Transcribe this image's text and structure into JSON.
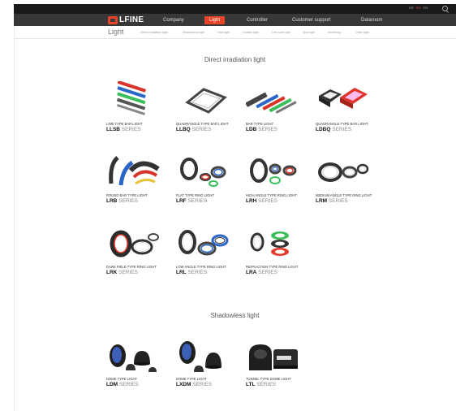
{
  "topbar": {
    "lang_kr": "KR",
    "lang_en": "EN",
    "lang_cn": "CN"
  },
  "nav": {
    "logo_text": "LFINE",
    "items": [
      "Company",
      "Light",
      "Controller",
      "Customer support",
      "Dataroom"
    ],
    "active_index": 1
  },
  "subnav": {
    "title": "Light",
    "items": [
      "Direct irradiation light",
      "Shadowless light",
      "Dark light",
      "Coaxial light",
      "Line scan light",
      "Spot light",
      "Accessory",
      "Order light"
    ]
  },
  "sections": [
    {
      "title": "Direct irradiation light",
      "products": [
        {
          "name": "LINE TYPE BAR LIGHT",
          "code": "LLSB",
          "suffix": "SERIES",
          "icon": "bar-lights-icon"
        },
        {
          "name": "QUADRANGLE TYPE BAR LIGHT",
          "code": "LLBQ",
          "suffix": "SERIES",
          "icon": "quadrangle-frame-icon"
        },
        {
          "name": "BAR TYPE LIGHT",
          "code": "LDB",
          "suffix": "SERIES",
          "icon": "bar-lights-icon"
        },
        {
          "name": "QUADRANGLE TYPE BAR LIGHT",
          "code": "LDBQ",
          "suffix": "SERIES",
          "icon": "square-frames-icon"
        },
        {
          "name": "ROUND BAR TYPE LIGHT",
          "code": "LRB",
          "suffix": "SERIES",
          "icon": "curved-bars-icon"
        },
        {
          "name": "FLAT TYPE RING LIGHT",
          "code": "LRF",
          "suffix": "SERIES",
          "icon": "ring-lights-icon"
        },
        {
          "name": "HIGH ANGLE TYPE RING LIGHT",
          "code": "LRH",
          "suffix": "SERIES",
          "icon": "ring-lights-icon"
        },
        {
          "name": "MEDIUM ANGLE TYPE RING LIGHT",
          "code": "LRM",
          "suffix": "SERIES",
          "icon": "ring-lights-icon"
        },
        {
          "name": "DARK FIELD TYPE RING LIGHT",
          "code": "LRK",
          "suffix": "SERIES",
          "icon": "ring-lights-icon"
        },
        {
          "name": "LOW ANGLE TYPE RING LIGHT",
          "code": "LRL",
          "suffix": "SERIES",
          "icon": "ring-lights-icon"
        },
        {
          "name": "REFRACTION TYPE RING LIGHT",
          "code": "LRA",
          "suffix": "SERIES",
          "icon": "stacked-rings-icon"
        }
      ]
    },
    {
      "title": "Shadowless light",
      "products": [
        {
          "name": "DOME TYPE LIGHT",
          "code": "LDM",
          "suffix": "SERIES",
          "icon": "dome-lights-icon"
        },
        {
          "name": "DOME TYPE LIGHT",
          "code": "LXDM",
          "suffix": "SERIES",
          "icon": "dome-lights-icon"
        },
        {
          "name": "TUNNEL TYPE DOME LIGHT",
          "code": "LTL",
          "suffix": "SERIES",
          "icon": "tunnel-light-icon"
        }
      ]
    }
  ],
  "colors": {
    "accent": "#e8442a",
    "nav_bg": "#383838",
    "topbar_bg": "#1a1a1a"
  }
}
